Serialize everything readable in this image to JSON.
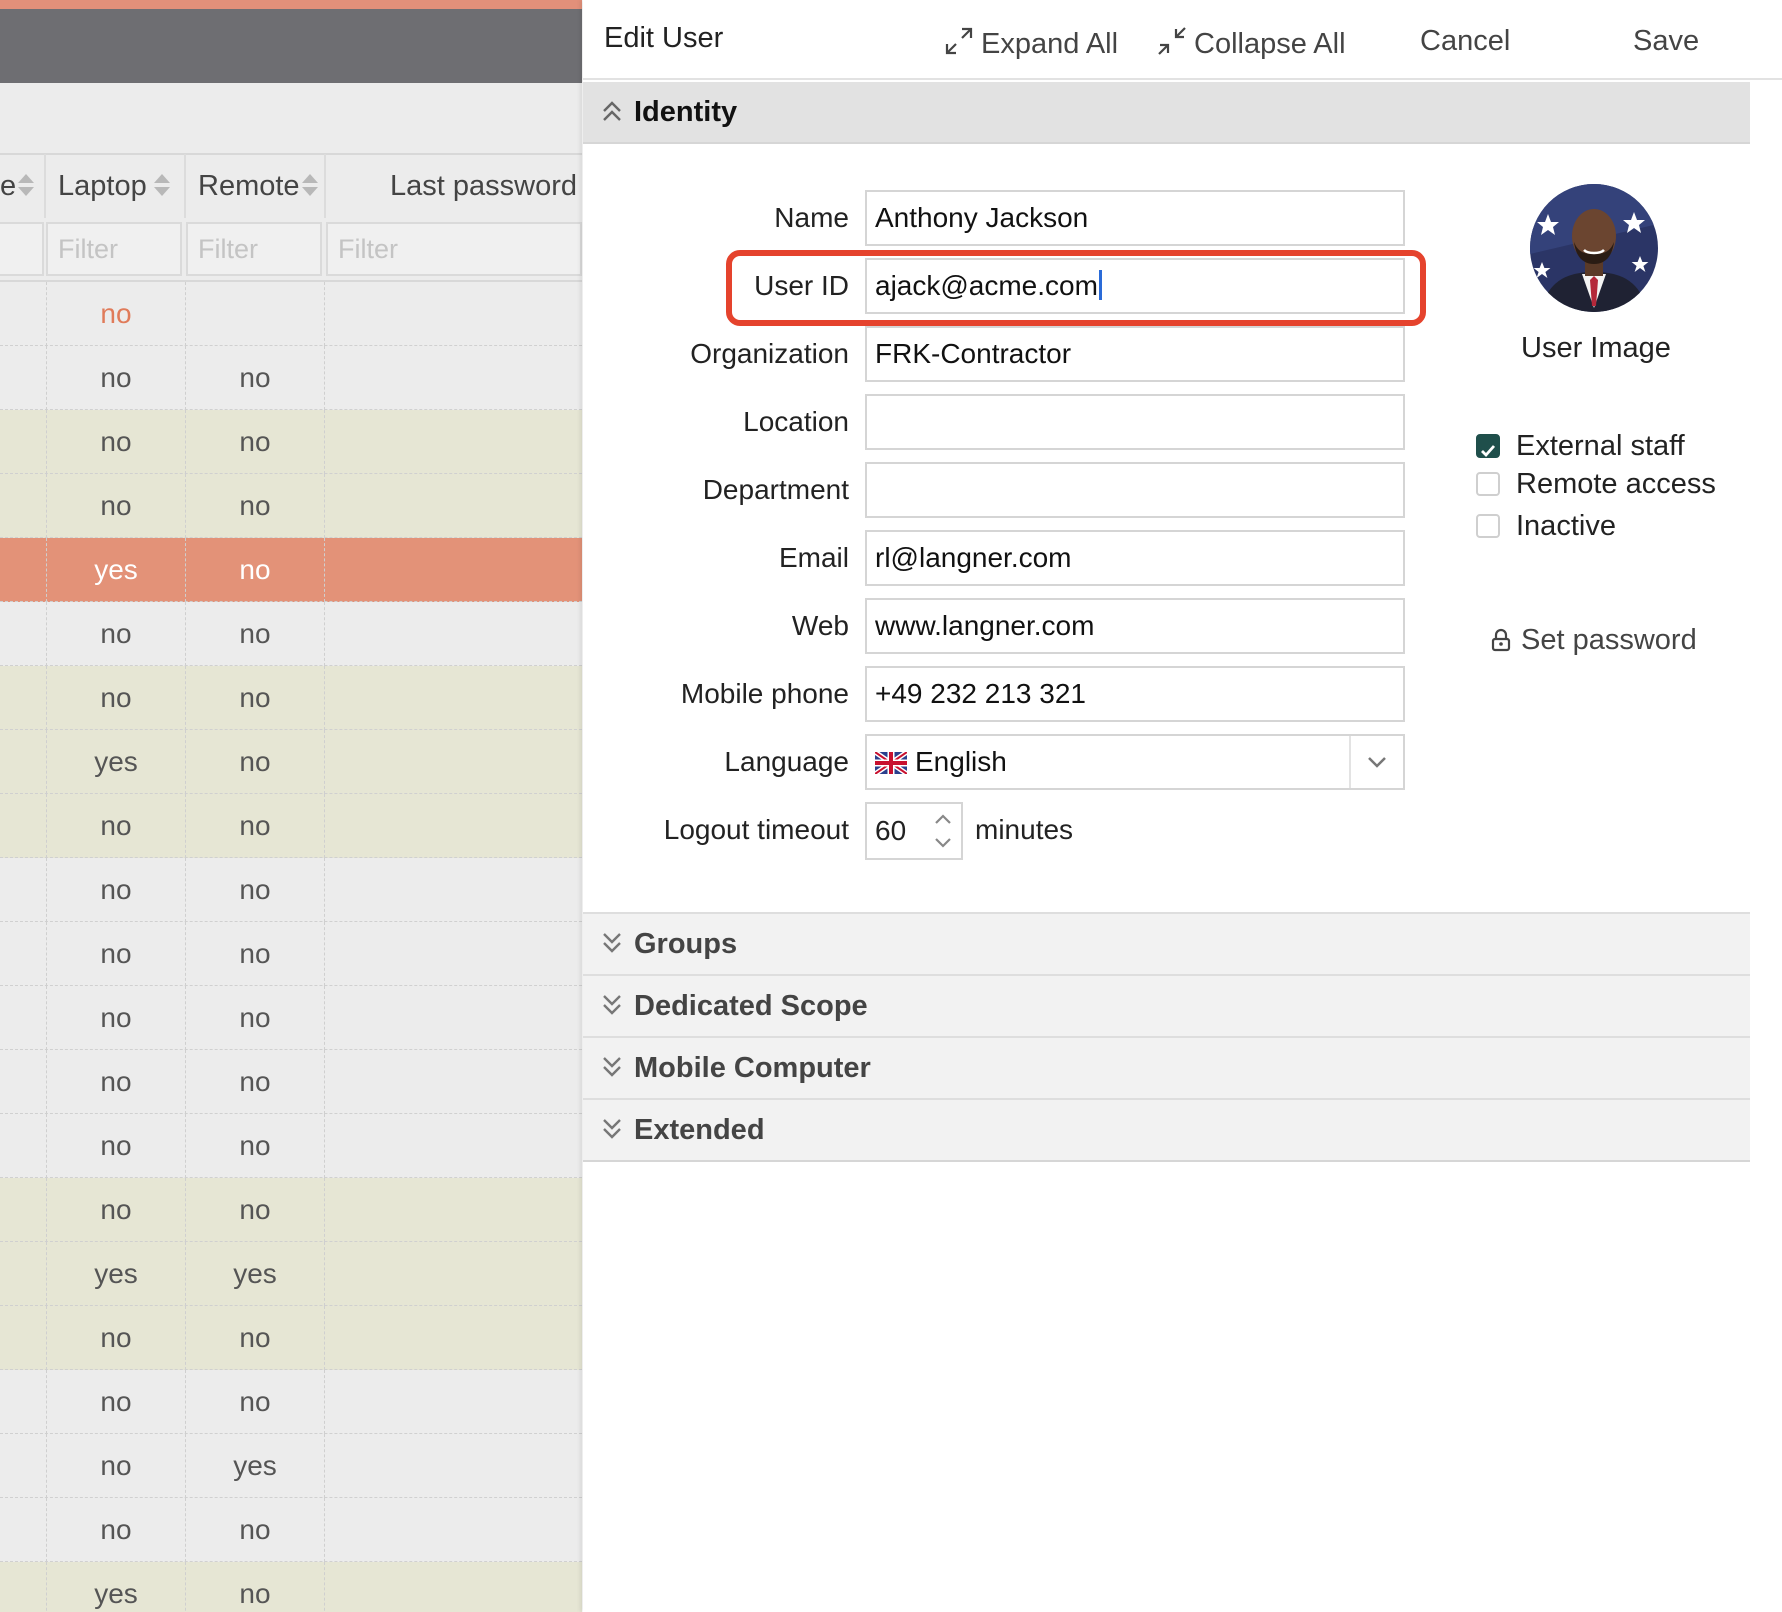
{
  "grid": {
    "columns": [
      {
        "label": "e"
      },
      {
        "label": "Laptop"
      },
      {
        "label": "Remote"
      },
      {
        "label": "Last password"
      }
    ],
    "filter_placeholder": "Filter",
    "rows": [
      {
        "laptop": "no",
        "remote": "",
        "style": "warn"
      },
      {
        "laptop": "no",
        "remote": "no",
        "style": "plain"
      },
      {
        "laptop": "no",
        "remote": "no",
        "style": "alt"
      },
      {
        "laptop": "no",
        "remote": "no",
        "style": "alt"
      },
      {
        "laptop": "yes",
        "remote": "no",
        "style": "sel"
      },
      {
        "laptop": "no",
        "remote": "no",
        "style": "plain"
      },
      {
        "laptop": "no",
        "remote": "no",
        "style": "alt"
      },
      {
        "laptop": "yes",
        "remote": "no",
        "style": "alt"
      },
      {
        "laptop": "no",
        "remote": "no",
        "style": "alt"
      },
      {
        "laptop": "no",
        "remote": "no",
        "style": "plain"
      },
      {
        "laptop": "no",
        "remote": "no",
        "style": "plain"
      },
      {
        "laptop": "no",
        "remote": "no",
        "style": "plain"
      },
      {
        "laptop": "no",
        "remote": "no",
        "style": "plain"
      },
      {
        "laptop": "no",
        "remote": "no",
        "style": "plain"
      },
      {
        "laptop": "no",
        "remote": "no",
        "style": "alt"
      },
      {
        "laptop": "yes",
        "remote": "yes",
        "style": "alt"
      },
      {
        "laptop": "no",
        "remote": "no",
        "style": "alt"
      },
      {
        "laptop": "no",
        "remote": "no",
        "style": "plain"
      },
      {
        "laptop": "no",
        "remote": "yes",
        "style": "plain"
      },
      {
        "laptop": "no",
        "remote": "no",
        "style": "plain"
      },
      {
        "laptop": "yes",
        "remote": "no",
        "style": "alt"
      }
    ]
  },
  "panel": {
    "title": "Edit User",
    "toolbar": {
      "expand_all": "Expand All",
      "collapse_all": "Collapse All",
      "cancel": "Cancel",
      "save": "Save"
    },
    "sections": {
      "identity": "Identity",
      "groups": "Groups",
      "dedicated_scope": "Dedicated Scope",
      "mobile_computer": "Mobile Computer",
      "extended": "Extended"
    },
    "fields": {
      "name": {
        "label": "Name",
        "value": "Anthony Jackson"
      },
      "user_id": {
        "label": "User ID",
        "value": "ajack@acme.com"
      },
      "organization": {
        "label": "Organization",
        "value": "FRK-Contractor"
      },
      "location": {
        "label": "Location",
        "value": ""
      },
      "department": {
        "label": "Department",
        "value": ""
      },
      "email": {
        "label": "Email",
        "value": "rl@langner.com"
      },
      "web": {
        "label": "Web",
        "value": "www.langner.com"
      },
      "mobile_phone": {
        "label": "Mobile phone",
        "value": "+49 232 213 321"
      },
      "language": {
        "label": "Language",
        "value": "English"
      },
      "logout_timeout": {
        "label": "Logout timeout",
        "value": "60",
        "unit": "minutes"
      }
    },
    "user_image_label": "User Image",
    "checkboxes": [
      {
        "label": "External staff",
        "checked": true
      },
      {
        "label": "Remote access",
        "checked": false
      },
      {
        "label": "Inactive",
        "checked": false
      }
    ],
    "set_password": "Set password"
  },
  "colors": {
    "accent_orange": "#e39278",
    "highlight_red": "#e5432d",
    "checkbox_green": "#1f4f4b",
    "row_alt": "#e6e6d4",
    "header_dark": "#6e6e72"
  }
}
